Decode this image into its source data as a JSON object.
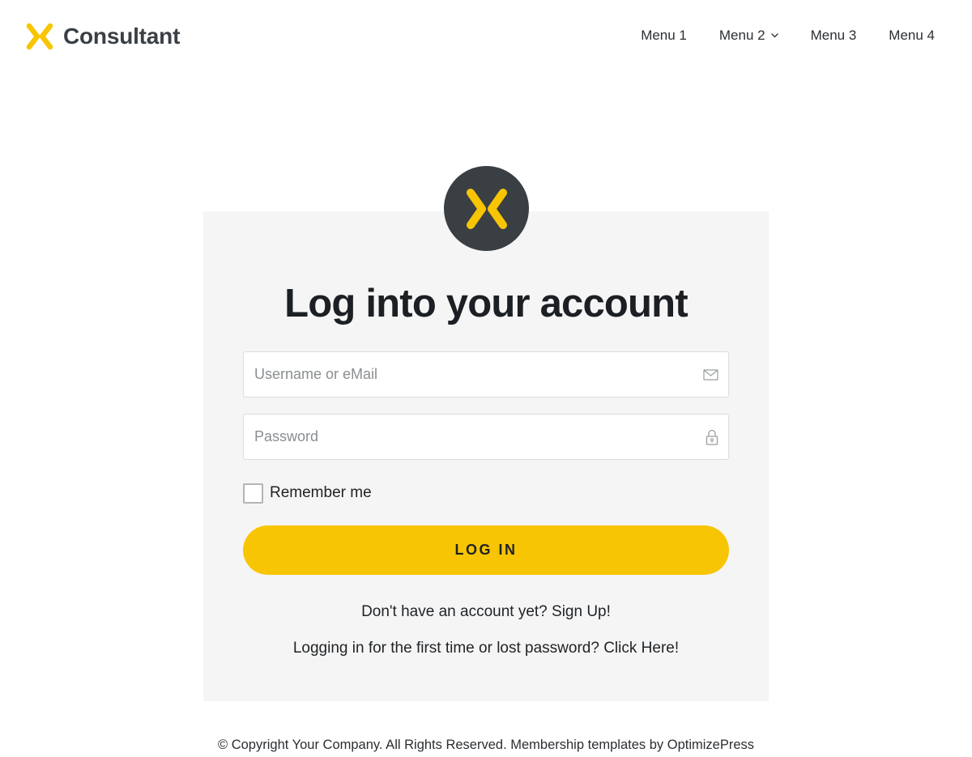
{
  "header": {
    "brand_name": "Consultant",
    "brand_icon": "x-logo-icon",
    "nav": [
      {
        "label": "Menu 1"
      },
      {
        "label": "Menu 2",
        "icon": "chevron-down-icon"
      },
      {
        "label": "Menu 3"
      },
      {
        "label": "Menu 4"
      }
    ]
  },
  "login": {
    "badge_icon": "x-logo-icon",
    "title": "Log into your account",
    "username_placeholder": "Username or eMail",
    "username_icon": "envelope-icon",
    "password_placeholder": "Password",
    "password_icon": "lock-icon",
    "remember_label": "Remember me",
    "remember_checked": false,
    "login_button": "LOG IN",
    "signup_text": "Don't have an account yet? Sign Up!",
    "reset_text": "Logging in for the first time or lost password? Click Here!"
  },
  "footer": {
    "text": "© Copyright Your Company.  All Rights Reserved. Membership templates by OptimizePress"
  },
  "colors": {
    "accent": "#F8C504",
    "dark": "#3A3F44",
    "card_background": "#F5F5F5"
  }
}
